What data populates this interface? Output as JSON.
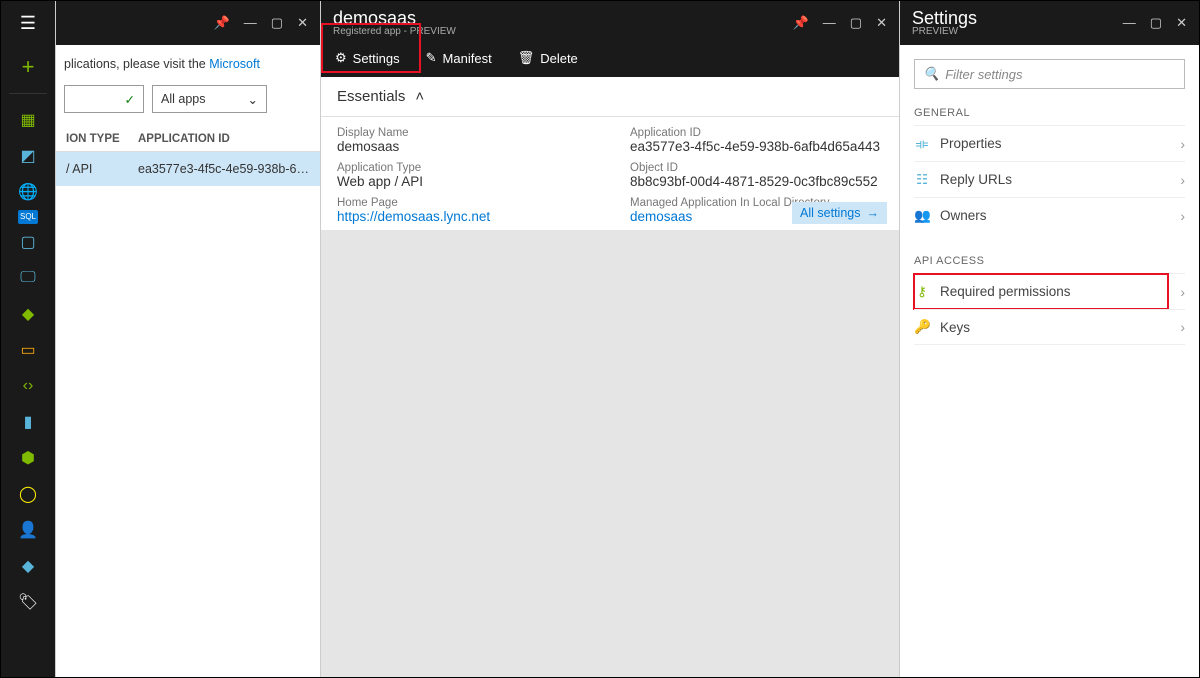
{
  "panel1": {
    "intro_pre": "plications, please visit the ",
    "intro_link": "Microsoft",
    "filter_allapps": "All apps",
    "col_type": "ION TYPE",
    "col_id": "APPLICATION ID",
    "row_type": " / API",
    "row_id": "ea3577e3-4f5c-4e59-938b-6afb..."
  },
  "panel2": {
    "title": "demosaas",
    "subtitle": "Registered app - PREVIEW",
    "tool_settings": "Settings",
    "tool_manifest": "Manifest",
    "tool_delete": "Delete",
    "essentials": "Essentials",
    "display_name_lbl": "Display Name",
    "display_name_val": "demosaas",
    "app_type_lbl": "Application Type",
    "app_type_val": "Web app / API",
    "home_page_lbl": "Home Page",
    "home_page_val": "https://demosaas.lync.net",
    "app_id_lbl": "Application ID",
    "app_id_val": "ea3577e3-4f5c-4e59-938b-6afb4d65a443",
    "obj_id_lbl": "Object ID",
    "obj_id_val": "8b8c93bf-00d4-4871-8529-0c3fbc89c552",
    "managed_lbl": "Managed Application In Local Directory",
    "managed_val": "demosaas",
    "all_settings": "All settings"
  },
  "panel3": {
    "title": "Settings",
    "subtitle": "PREVIEW",
    "filter_placeholder": "Filter settings",
    "group_general": "GENERAL",
    "row_properties": "Properties",
    "row_reply": "Reply URLs",
    "row_owners": "Owners",
    "group_api": "API ACCESS",
    "row_required": "Required permissions",
    "row_keys": "Keys"
  }
}
